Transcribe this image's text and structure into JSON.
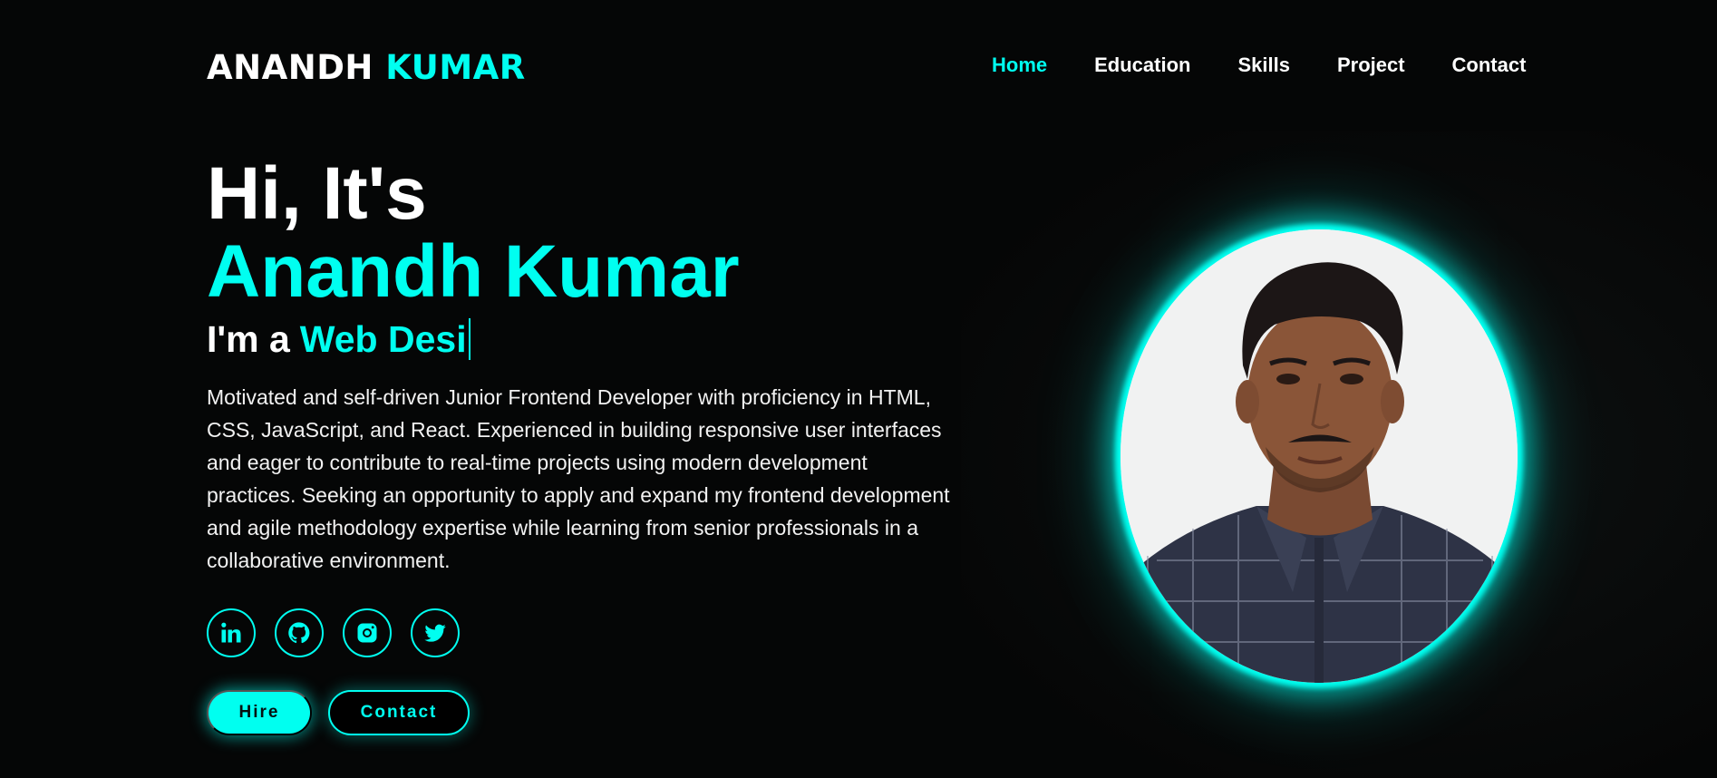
{
  "header": {
    "logo_first": "ANANDH",
    "logo_second": "KUMAR",
    "nav": [
      {
        "label": "Home",
        "active": true
      },
      {
        "label": "Education",
        "active": false
      },
      {
        "label": "Skills",
        "active": false
      },
      {
        "label": "Project",
        "active": false
      },
      {
        "label": "Contact",
        "active": false
      }
    ]
  },
  "hero": {
    "greeting": "Hi, It's",
    "name": "Anandh Kumar",
    "role_prefix": "I'm a",
    "role_typed": "Web Desi",
    "bio": "Motivated and self-driven Junior Frontend Developer with proficiency in HTML, CSS, JavaScript, and React. Experienced in building responsive user interfaces and eager to contribute to real-time projects using modern development practices. Seeking an opportunity to apply and expand my frontend development and agile methodology expertise while learning from senior professionals in a collaborative environment.",
    "socials": [
      "linkedin-icon",
      "github-icon",
      "instagram-icon",
      "twitter-icon"
    ],
    "buttons": {
      "hire": "Hire",
      "contact": "Contact"
    }
  },
  "theme": {
    "accent": "#00fff0",
    "background": "#050606"
  }
}
